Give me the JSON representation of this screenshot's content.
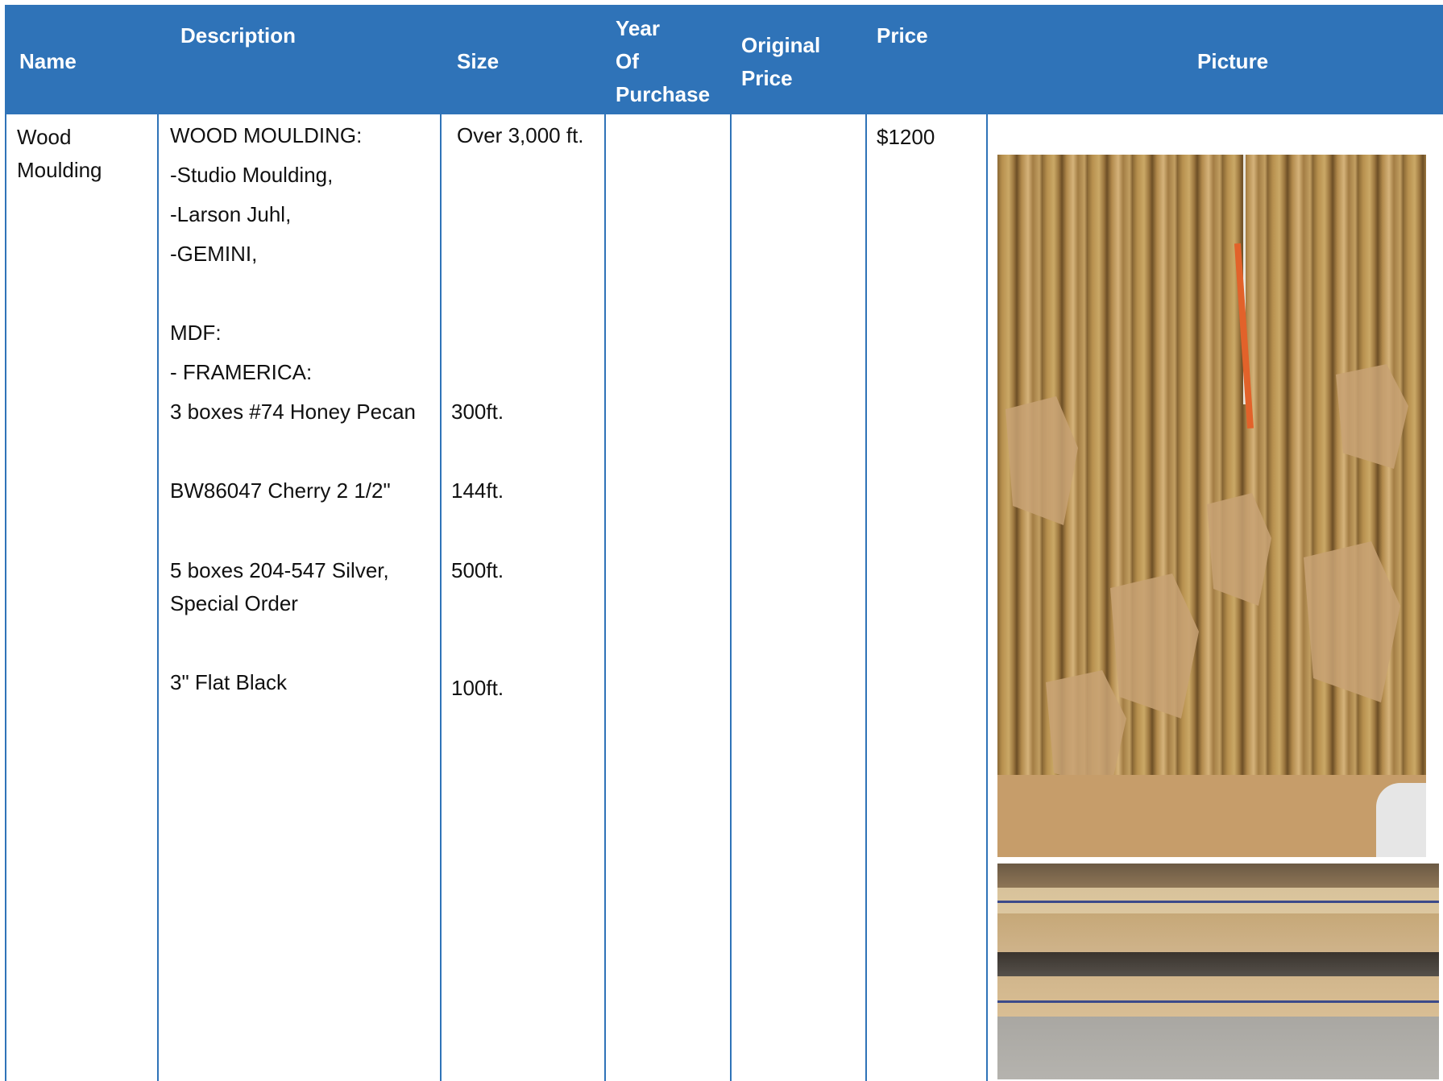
{
  "table": {
    "headers": {
      "name": "Name",
      "description": "Description",
      "size": "Size",
      "year_line1": "Year",
      "year_line2": "Of",
      "year_line3": "Purchase",
      "original_line1": "Original",
      "original_line2": "Price",
      "price": "Price",
      "picture": "Picture"
    },
    "row": {
      "name_line1": "Wood",
      "name_line2": "Moulding",
      "description_lines": [
        "WOOD MOULDING:",
        "-Studio Moulding,",
        "-Larson Juhl,",
        "-GEMINI,",
        "MDF:",
        "- FRAMERICA:",
        "3 boxes #74 Honey Pecan",
        "BW86047 Cherry 2 1/2\"",
        "5 boxes 204-547 Silver,",
        "Special Order",
        "3\" Flat Black"
      ],
      "size_lines": [
        "Over 3,000 ft.",
        "300ft.",
        "144ft.",
        "500ft.",
        "100ft."
      ],
      "year_of_purchase": "",
      "original_price": "",
      "price": "$1200",
      "pictures": [
        "moulding-stack-photo",
        "framerica-boxes-photo"
      ]
    }
  },
  "colors": {
    "header_bg": "#2f73b8",
    "header_text": "#ffffff",
    "grid_line": "#2f73b8"
  }
}
